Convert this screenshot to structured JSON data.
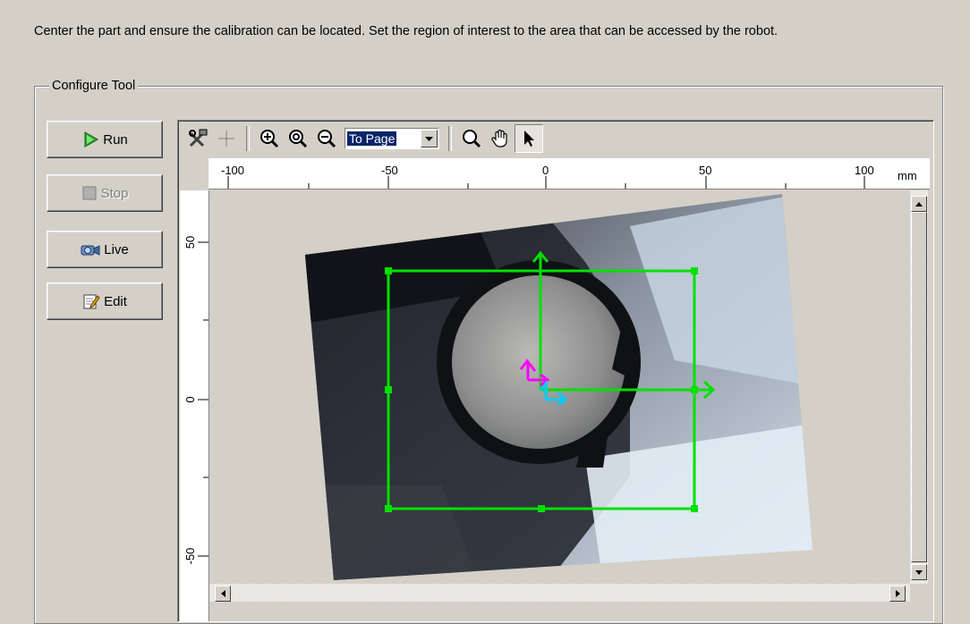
{
  "instructions": "Center the part and ensure the calibration can be located. Set the region of interest to the area that can be accessed by the robot.",
  "group_title": "Configure Tool",
  "buttons": {
    "run": "Run",
    "stop": "Stop",
    "live": "Live",
    "edit": "Edit"
  },
  "toolbar": {
    "zoom_value": "To Page",
    "icons": [
      "tools-icon",
      "crosshair-icon",
      "zoom-in-icon",
      "zoom-reset-icon",
      "zoom-out-icon",
      "magnify-icon",
      "pan-hand-icon",
      "pointer-icon"
    ]
  },
  "ruler": {
    "top_labels": [
      "-100",
      "-50",
      "0",
      "50",
      "100"
    ],
    "unit": "mm",
    "left_labels": [
      "50",
      "0",
      "-50"
    ]
  },
  "colors": {
    "roi": "#00e000",
    "calib_axis_1": "#ff00ff",
    "calib_axis_2": "#00ccff"
  }
}
